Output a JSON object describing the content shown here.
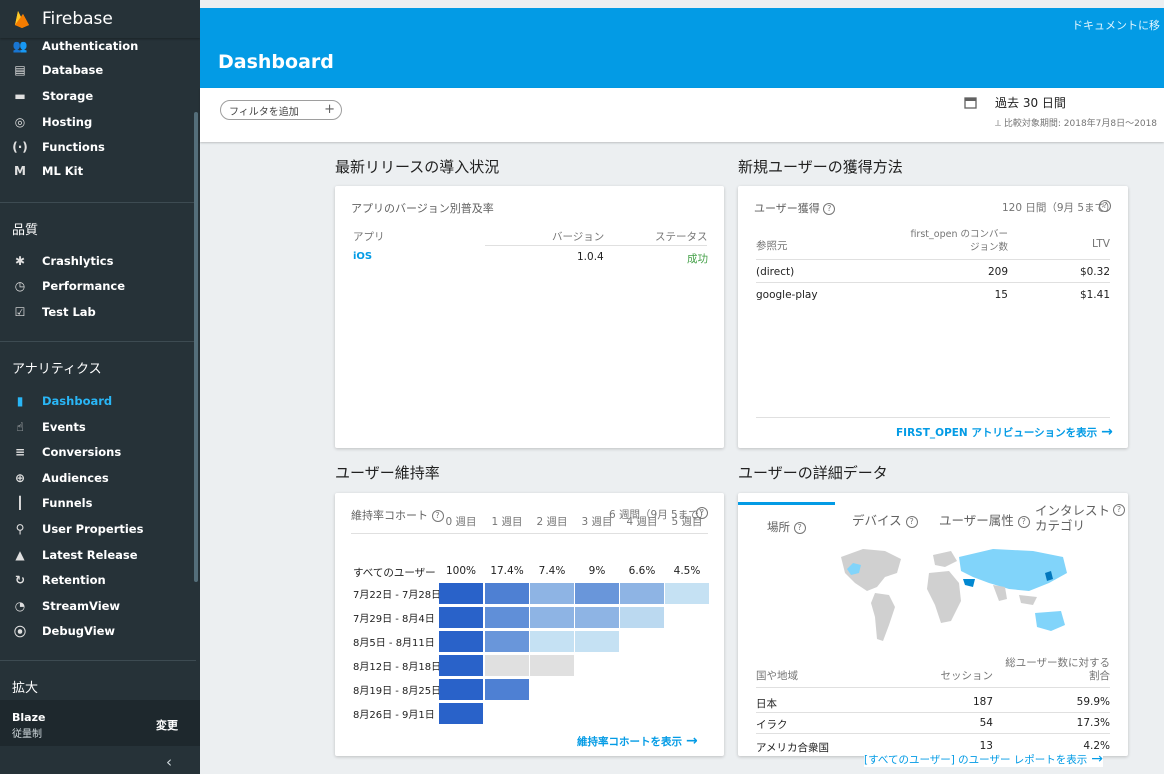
{
  "app": {
    "title": "Firebase"
  },
  "sidebar": {
    "top_items": [
      {
        "label": "Authentication",
        "icon": "people-icon"
      },
      {
        "label": "Database",
        "icon": "database-icon"
      },
      {
        "label": "Storage",
        "icon": "folder-icon"
      },
      {
        "label": "Hosting",
        "icon": "hosting-icon"
      },
      {
        "label": "Functions",
        "icon": "functions-icon"
      },
      {
        "label": "ML Kit",
        "icon": "mlkit-icon"
      }
    ],
    "quality_title": "品質",
    "quality_items": [
      {
        "label": "Crashlytics",
        "icon": "crashlytics-icon"
      },
      {
        "label": "Performance",
        "icon": "performance-icon"
      },
      {
        "label": "Test Lab",
        "icon": "testlab-icon"
      }
    ],
    "analytics_title": "アナリティクス",
    "analytics_items": [
      {
        "label": "Dashboard",
        "icon": "dashboard-icon",
        "active": true
      },
      {
        "label": "Events",
        "icon": "events-icon"
      },
      {
        "label": "Conversions",
        "icon": "conversions-icon"
      },
      {
        "label": "Audiences",
        "icon": "audiences-icon"
      },
      {
        "label": "Funnels",
        "icon": "funnels-icon"
      },
      {
        "label": "User Properties",
        "icon": "user-properties-icon"
      },
      {
        "label": "Latest Release",
        "icon": "latest-release-icon"
      },
      {
        "label": "Retention",
        "icon": "retention-icon"
      },
      {
        "label": "StreamView",
        "icon": "streamview-icon"
      },
      {
        "label": "DebugView",
        "icon": "debugview-icon"
      }
    ],
    "extend_title": "拡大",
    "plan_name": "Blaze",
    "plan_sub": "従量制",
    "plan_change": "変更",
    "collapse_glyph": "‹"
  },
  "header": {
    "title": "Dashboard",
    "doc_link": "ドキュメントに移"
  },
  "filter": {
    "chip_label": "フィルタを追加",
    "chip_plus": "+",
    "date_range": "過去 30 日間",
    "compare": "比較対象期間: 2018年7月8日〜2018"
  },
  "release": {
    "section_title": "最新リリースの導入状況",
    "card_title": "アプリのバージョン別普及率",
    "headers": [
      "アプリ",
      "バージョン",
      "ステータス"
    ],
    "rows": [
      {
        "app": "iOS",
        "version": "1.0.4",
        "status": "成功"
      }
    ]
  },
  "acquisition": {
    "section_title": "新規ユーザーの獲得方法",
    "card_title": "ユーザー獲得",
    "period": "120 日間（9月 5まで）",
    "headers": [
      "参照元",
      "first_open のコンバー\nジョン数",
      "LTV"
    ],
    "rows": [
      {
        "source": "(direct)",
        "count": "209",
        "ltv": "$0.32"
      },
      {
        "source": "google-play",
        "count": "15",
        "ltv": "$1.41"
      }
    ],
    "link": "FIRST_OPEN アトリビューションを表示"
  },
  "retention": {
    "section_title": "ユーザー維持率",
    "card_title": "維持率コホート",
    "period": "6 週間（9月 5まで）",
    "week_headers": [
      "0 週目",
      "1 週目",
      "2 週目",
      "3 週目",
      "4 週目",
      "5 週目"
    ],
    "all_users_label": "すべてのユーザー",
    "all_users_values": [
      "100%",
      "17.4%",
      "7.4%",
      "9%",
      "6.6%",
      "4.5%"
    ],
    "cohorts": [
      {
        "label": "7月22日 - 7月28日",
        "levels": [
          1.0,
          0.8,
          0.45,
          0.65,
          0.45,
          0.15
        ]
      },
      {
        "label": "7月29日 - 8月4日",
        "levels": [
          1.0,
          0.7,
          0.45,
          0.45,
          0.2
        ]
      },
      {
        "label": "8月5日 - 8月11日",
        "levels": [
          1.0,
          0.65,
          0.15,
          0.15
        ]
      },
      {
        "label": "8月12日 - 8月18日",
        "levels": [
          1.0,
          0.0,
          0.0
        ]
      },
      {
        "label": "8月19日 - 8月25日",
        "levels": [
          1.0,
          0.8
        ]
      },
      {
        "label": "8月26日 - 9月1日",
        "levels": [
          1.0
        ]
      }
    ],
    "link": "維持率コホートを表示"
  },
  "details": {
    "section_title": "ユーザーの詳細データ",
    "tabs": [
      "場所",
      "デバイス",
      "ユーザー属性",
      "インタレスト\nカテゴリ"
    ],
    "headers": [
      "国や地域",
      "セッション",
      "総ユーザー数に対する\n割合"
    ],
    "rows": [
      {
        "country": "日本",
        "sessions": "187",
        "share": "59.9%"
      },
      {
        "country": "イラク",
        "sessions": "54",
        "share": "17.3%"
      },
      {
        "country": "アメリカ合衆国",
        "sessions": "13",
        "share": "4.2%"
      }
    ],
    "link": "[すべてのユーザー] のユーザー レポートを表示"
  },
  "colors": {
    "accent": "#039be5",
    "sidebar": "#263238",
    "success": "#43a047",
    "heat_strong": "#2962c9",
    "heat_light": "#e0f7fa",
    "heat_gray": "#e0e0e0"
  }
}
